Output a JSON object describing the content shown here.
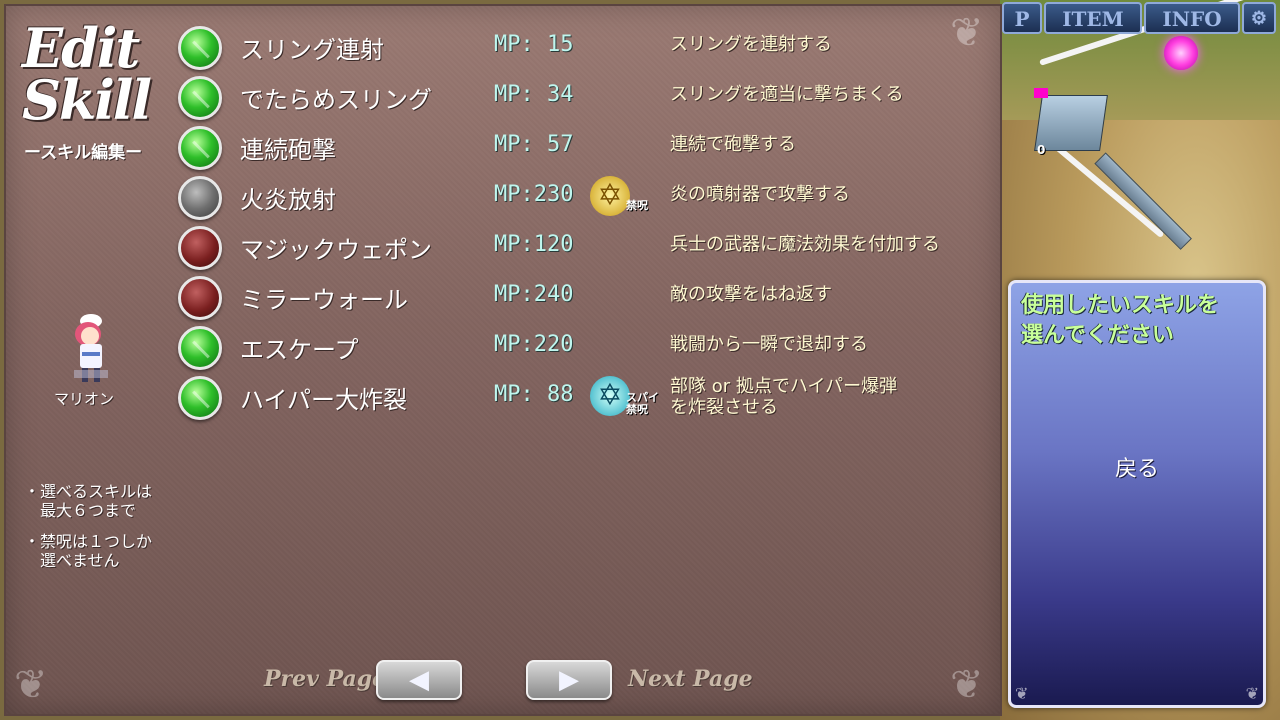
{
  "header": {
    "title_line1": "Edit",
    "title_line2": "Skill",
    "subtitle": "ースキル編集ー"
  },
  "character": {
    "name": "マリオン"
  },
  "notes": [
    "・選べるスキルは\n　最大６つまで",
    "・禁呪は１つしか\n　選べません"
  ],
  "skills": [
    {
      "name": "スリング連射",
      "mp": "MP: 15",
      "description": "スリングを連射する",
      "state": "selected",
      "badge": ""
    },
    {
      "name": "でたらめスリング",
      "mp": "MP: 34",
      "description": "スリングを適当に撃ちまくる",
      "state": "selected",
      "badge": ""
    },
    {
      "name": "連続砲撃",
      "mp": "MP: 57",
      "description": "連続で砲撃する",
      "state": "selected",
      "badge": ""
    },
    {
      "name": "火炎放射",
      "mp": "MP:230",
      "description": "炎の噴射器で攻撃する",
      "state": "disabled",
      "badge": "禁呪"
    },
    {
      "name": "マジックウェポン",
      "mp": "MP:120",
      "description": "兵士の武器に魔法効果を付加する",
      "state": "unselected",
      "badge": ""
    },
    {
      "name": "ミラーウォール",
      "mp": "MP:240",
      "description": "敵の攻撃をはね返す",
      "state": "unselected",
      "badge": ""
    },
    {
      "name": "エスケープ",
      "mp": "MP:220",
      "description": "戦闘から一瞬で退却する",
      "state": "selected",
      "badge": ""
    },
    {
      "name": "ハイパー大炸裂",
      "mp": "MP: 88",
      "description": "部隊 or 拠点でハイパー爆弾\nを炸裂させる",
      "state": "selected",
      "badge": "スパイ\n禁呪"
    }
  ],
  "navigation": {
    "prev_label": "Prev Page",
    "next_label": "Next Page"
  },
  "dialog": {
    "message": "使用したいスキルを\n選んでください",
    "back_label": "戻る"
  },
  "top_menu": {
    "map_fragment": "P",
    "item": "ITEM",
    "info": "INFO"
  },
  "map": {
    "counter": "0"
  },
  "colors": {
    "selected_gem": "#2fbf2a",
    "unselected_gem": "#7a1f1f",
    "disabled_gem": "#707070",
    "mp_text": "#bff6ee",
    "description_text": "#fff9d2",
    "dialog_message": "#c8ff9a"
  },
  "icons": {
    "gem_selected": "green-orb-icon",
    "gem_unselected": "red-orb-icon",
    "gem_disabled": "gray-orb-icon",
    "badge_forbidden": "gold-hexagram-icon",
    "badge_spy_forbidden": "teal-hexagram-icon"
  }
}
